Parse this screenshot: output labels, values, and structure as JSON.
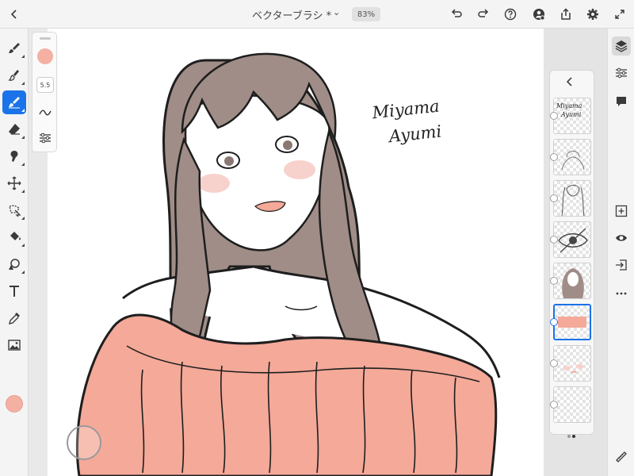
{
  "topbar": {
    "back_icon": "chevron-left-icon",
    "title": "ベクターブラシ *",
    "title_menu_icon": "chevron-down-icon",
    "zoom": "83%",
    "actions": [
      "undo-icon",
      "redo-icon",
      "help-icon",
      "account-icon",
      "share-icon",
      "settings-icon",
      "fullscreen-icon"
    ]
  },
  "left_tools": [
    "pixel-brush-icon",
    "live-brush-icon",
    "vector-brush-icon",
    "eraser-icon",
    "smudge-icon",
    "transform-icon",
    "selection-icon",
    "fill-icon",
    "shape-icon",
    "text-icon",
    "eyedropper-icon",
    "image-icon"
  ],
  "active_tool": "vector-brush-icon",
  "color": {
    "current": "#f4b0a2"
  },
  "brush_panel": {
    "size": "5.5",
    "icons": [
      "stroke-smoothing-icon",
      "brush-settings-icon"
    ]
  },
  "canvas": {
    "signature_line1": "Miyama",
    "signature_line2": "Ayumi",
    "colors": {
      "hair": "#a08d87",
      "dress": "#f4a999",
      "skin_blush": "#f7d2cc",
      "line": "#1e1e1e"
    }
  },
  "layers_panel": {
    "back_icon": "chevron-left-icon",
    "thumb_text_line1": "Miyama",
    "thumb_text_line2": "Ayumi",
    "layer_count": 8,
    "selected_index": 5
  },
  "right_tools": [
    "layers-icon",
    "adjustments-icon",
    "comment-icon",
    "add-layer-icon",
    "visibility-icon",
    "import-icon",
    "more-icon",
    "ruler-icon"
  ],
  "accent": "#1a73e8"
}
